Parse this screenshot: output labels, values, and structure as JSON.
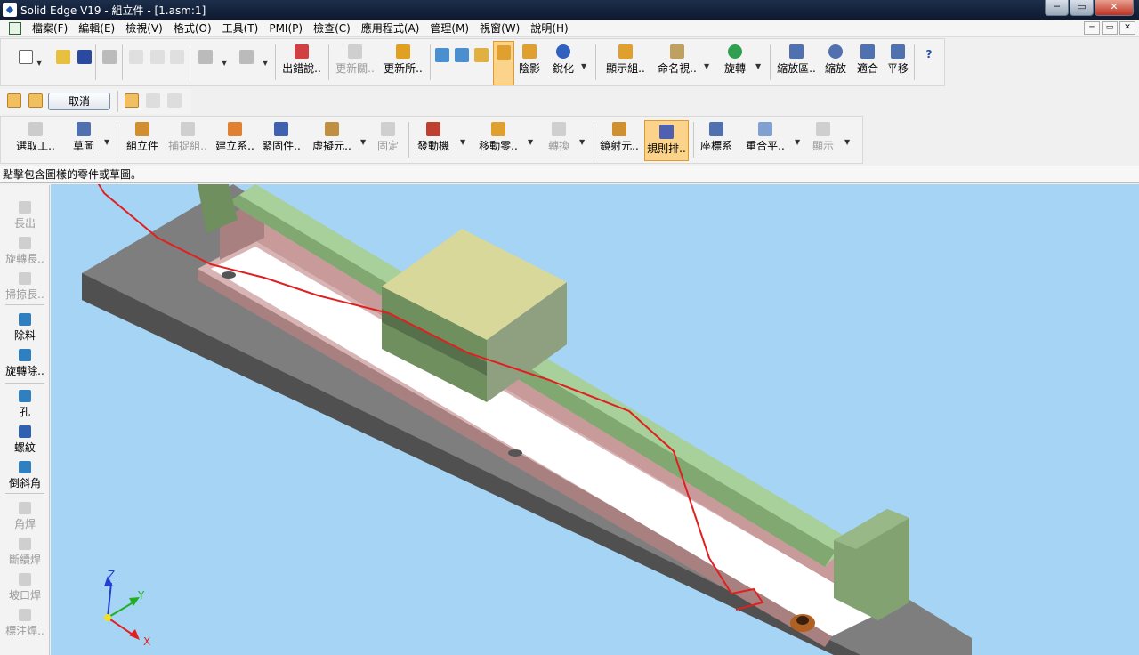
{
  "window": {
    "title": "Solid Edge V19 - 組立件 - [1.asm:1]",
    "minimize": "─",
    "restore": "▭",
    "close": "✕"
  },
  "menu": [
    "檔案(F)",
    "編輯(E)",
    "檢視(V)",
    "格式(O)",
    "工具(T)",
    "PMI(P)",
    "檢查(C)",
    "應用程式(A)",
    "管理(M)",
    "視窗(W)",
    "說明(H)"
  ],
  "mdi": {
    "minimize": "─",
    "restore": "▭",
    "close": "✕"
  },
  "toolbar1": {
    "error_report": "出錯說..",
    "update_links": "更新關..",
    "update_all": "更新所..",
    "shading": "陰影",
    "sharpen": "銳化",
    "show_group": "顯示組..",
    "named_view": "命名視..",
    "rotate": "旋轉",
    "zoom_area": "縮放區..",
    "zoom": "縮放",
    "fit": "適合",
    "pan": "平移",
    "help": "?"
  },
  "toolbar2": {
    "cancel": "取消"
  },
  "toolbar3": {
    "select_tool": "選取工..",
    "sketch": "草圖",
    "assemble": "組立件",
    "capture": "捕捉組..",
    "create_part": "建立系..",
    "fastener": "緊固件..",
    "virtual": "虛擬元..",
    "fix": "固定",
    "motor": "發動機",
    "move_part": "移動零..",
    "transform": "轉換",
    "mirror": "鏡射元..",
    "pattern": "規則排..",
    "coord_sys": "座標系",
    "coincident_plane": "重合平..",
    "show": "顯示"
  },
  "prompt": "點擊包含圖樣的零件或草圖。",
  "sidebar": {
    "protrusion": "長出",
    "revolve_protrusion": "旋轉長..",
    "sweep_protrusion": "掃掠長..",
    "cutout": "除料",
    "revolve_cutout": "旋轉除..",
    "hole": "孔",
    "thread": "螺紋",
    "chamfer": "倒斜角",
    "fillet_weld": "角焊",
    "intermittent_weld": "斷續焊",
    "groove_weld": "坡口焊",
    "label_weld": "標注焊.."
  },
  "axes": {
    "z": "Z",
    "y": "Y",
    "x": "X"
  }
}
